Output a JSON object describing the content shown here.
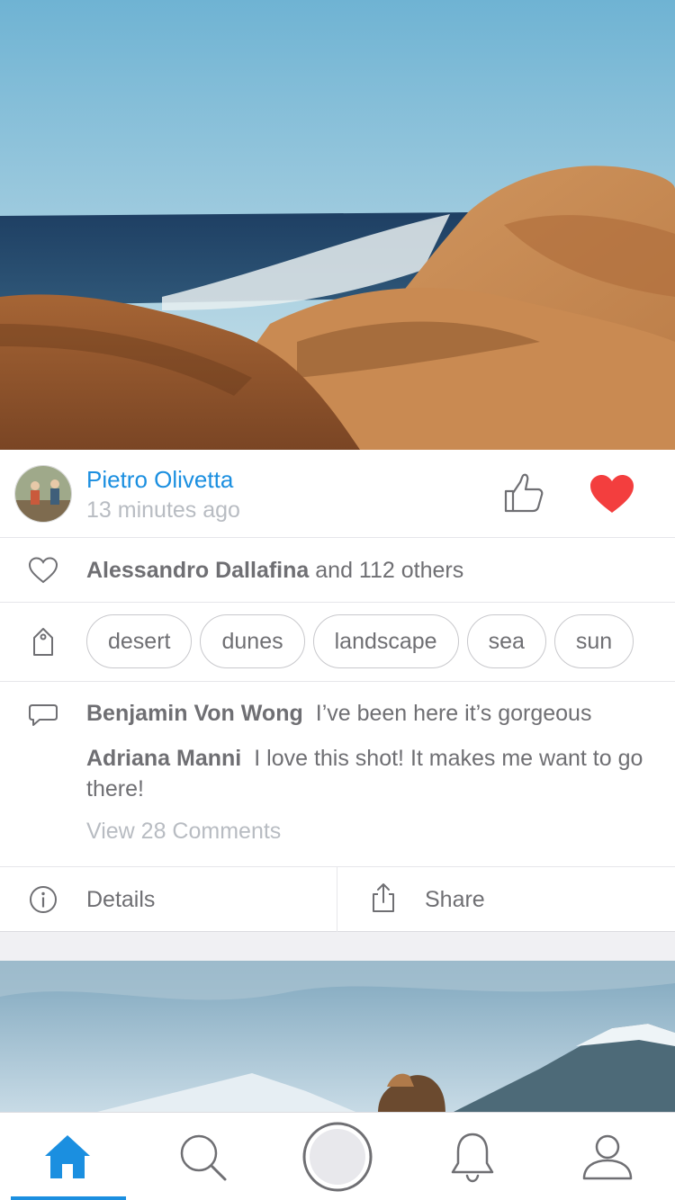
{
  "post": {
    "author": "Pietro Olivetta",
    "time": "13 minutes ago",
    "likes_name": "Alessandro Dallafina",
    "likes_rest": " and 112 others",
    "tags": [
      "desert",
      "dunes",
      "landscape",
      "sea",
      "sun"
    ],
    "comments": [
      {
        "user": "Benjamin Von Wong",
        "text": "I’ve been here it’s gorgeous"
      },
      {
        "user": "Adriana Manni",
        "text": "I love this shot! It makes me want to go there!"
      }
    ],
    "view_comments": "View 28 Comments",
    "liked": true
  },
  "actions": {
    "details": "Details",
    "share": "Share"
  },
  "tabbar": {
    "items": [
      "home",
      "search",
      "camera",
      "notifications",
      "profile"
    ],
    "active": "home"
  },
  "colors": {
    "accent": "#1b8fe0",
    "heart": "#f33e3e",
    "text": "#6f6f73",
    "muted": "#b8bcc2"
  }
}
